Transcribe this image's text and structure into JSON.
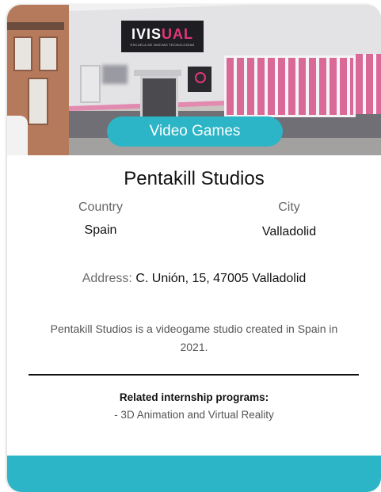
{
  "card": {
    "category": "Video Games",
    "title": "Pentakill Studios",
    "country_label": "Country",
    "country_value": "Spain",
    "city_label": "City",
    "city_value": "Valladolid",
    "address_label": "Address:",
    "address_value": "C. Unión, 15, 47005 Valladolid",
    "description": "Pentakill Studios is a videogame studio created in Spain in 2021.",
    "related_title": "Related internship programs:",
    "related_items": [
      "- 3D Animation and Virtual Reality"
    ]
  },
  "photo": {
    "sign_brand_a": "IVIS",
    "sign_brand_b": "UAL",
    "sign_subtitle": "ESCUELA DE NUEVAS TECNOLOGÍAS"
  },
  "colors": {
    "accent": "#2cb5c6",
    "title_text": "#111111",
    "muted_text": "#666666"
  }
}
